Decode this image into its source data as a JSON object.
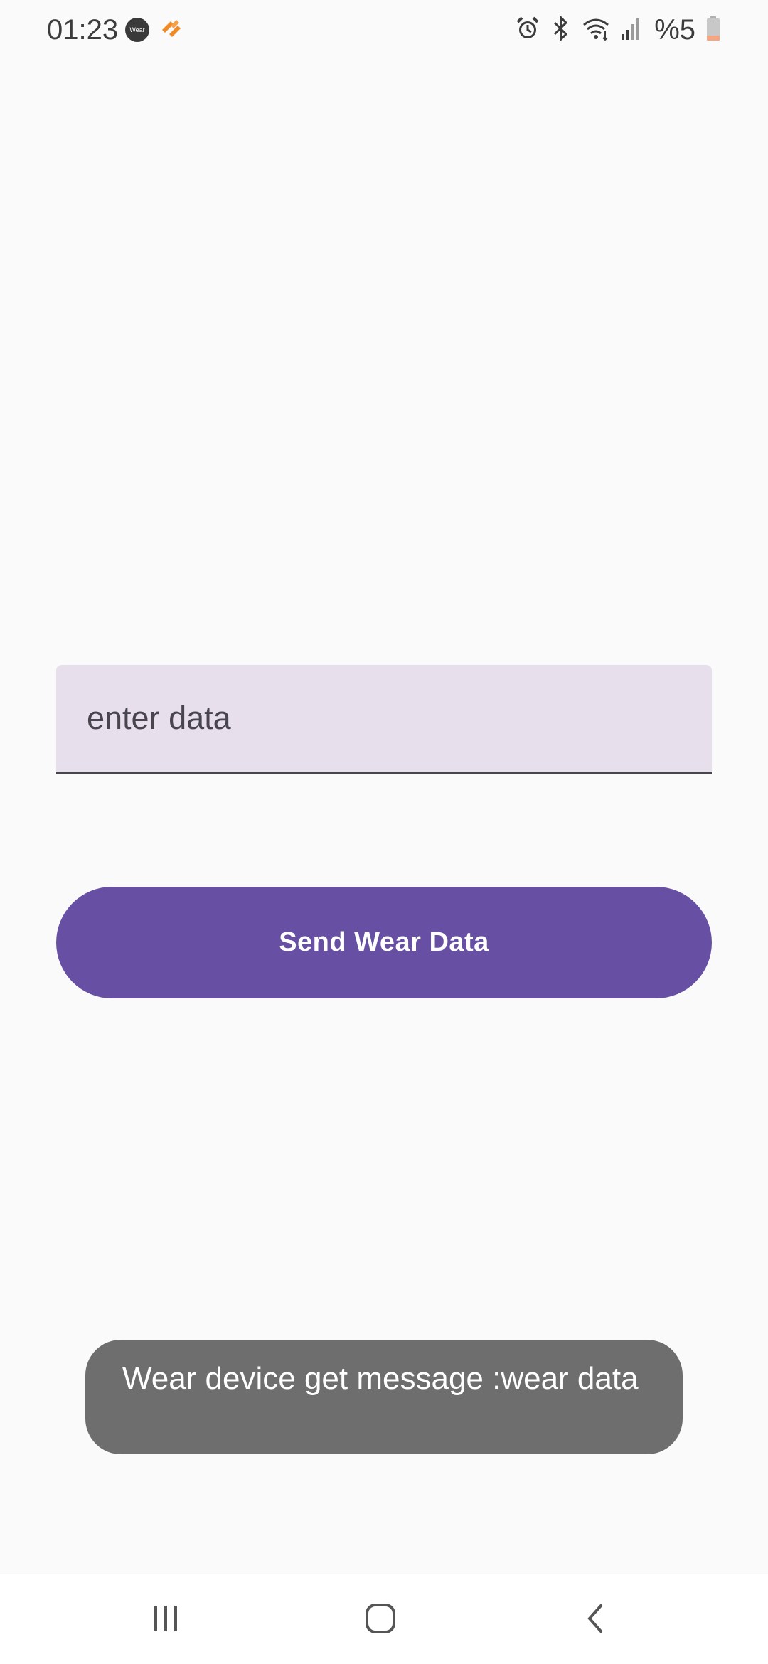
{
  "status_bar": {
    "time": "01:23",
    "wear_badge": "Wear",
    "battery": "%5",
    "icons": [
      "wear-os-icon",
      "fitness-app-icon",
      "alarm-icon",
      "bluetooth-icon",
      "wifi-icon",
      "signal-icon",
      "battery-icon"
    ]
  },
  "form": {
    "input_placeholder": "enter data",
    "input_value": "",
    "send_button_label": "Send Wear Data"
  },
  "toast": {
    "message": "Wear device get message :wear data"
  },
  "nav_bar": {
    "icons": [
      "recent-apps-icon",
      "home-icon",
      "back-icon"
    ]
  },
  "colors": {
    "background": "#fafafa",
    "input_fill": "#e7e0ec",
    "input_underline": "#49454f",
    "button": "#6750a4",
    "button_text": "#ffffff",
    "toast": "#6e6e6e",
    "nav_bar": "#ffffff"
  }
}
